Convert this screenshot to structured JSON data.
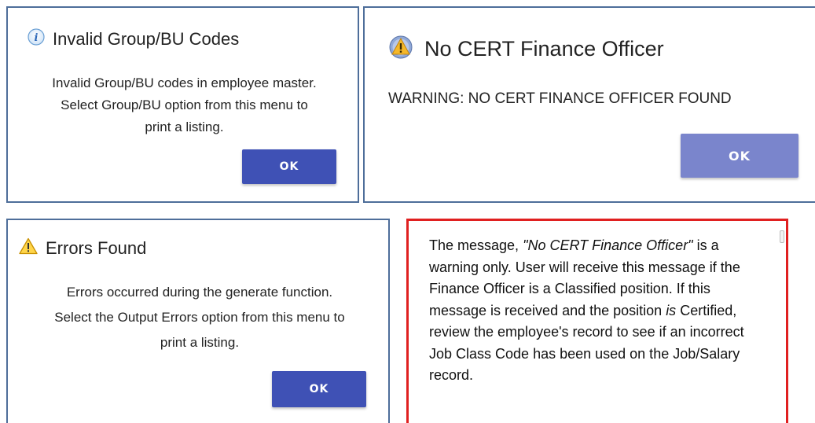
{
  "dialogs": [
    {
      "title": "Invalid Group/BU Codes",
      "icon": "info-icon",
      "body_lines": [
        "Invalid Group/BU codes in employee master.",
        "Select Group/BU option from this menu to",
        "print a listing."
      ],
      "ok_label": "OK"
    },
    {
      "title": "No CERT Finance Officer",
      "icon": "warning-circle-icon",
      "body_lines": [
        "WARNING: NO CERT FINANCE OFFICER FOUND"
      ],
      "ok_label": "OK"
    },
    {
      "title": "Errors Found",
      "icon": "warning-triangle-icon",
      "body_lines": [
        "Errors occurred during the generate function.",
        "Select the Output Errors option from this menu to",
        "print a listing."
      ],
      "ok_label": "OK"
    }
  ],
  "note": {
    "seg1": "The message, ",
    "seg2_italic": "\"No CERT Finance Officer\"",
    "seg3": " is a warning only. User will receive this message if the Finance Officer is a Classified position. If this message is received and the position ",
    "seg4_italic": "is",
    "seg5": " Certified, review the employee's record to see if an incorrect Job Class Code has been used on the Job/Salary record."
  },
  "colors": {
    "ok_primary": "#3f51b5",
    "ok_secondary": "#7a85cc",
    "note_border": "#e02020",
    "dialog_border": "#4e6e9a"
  }
}
